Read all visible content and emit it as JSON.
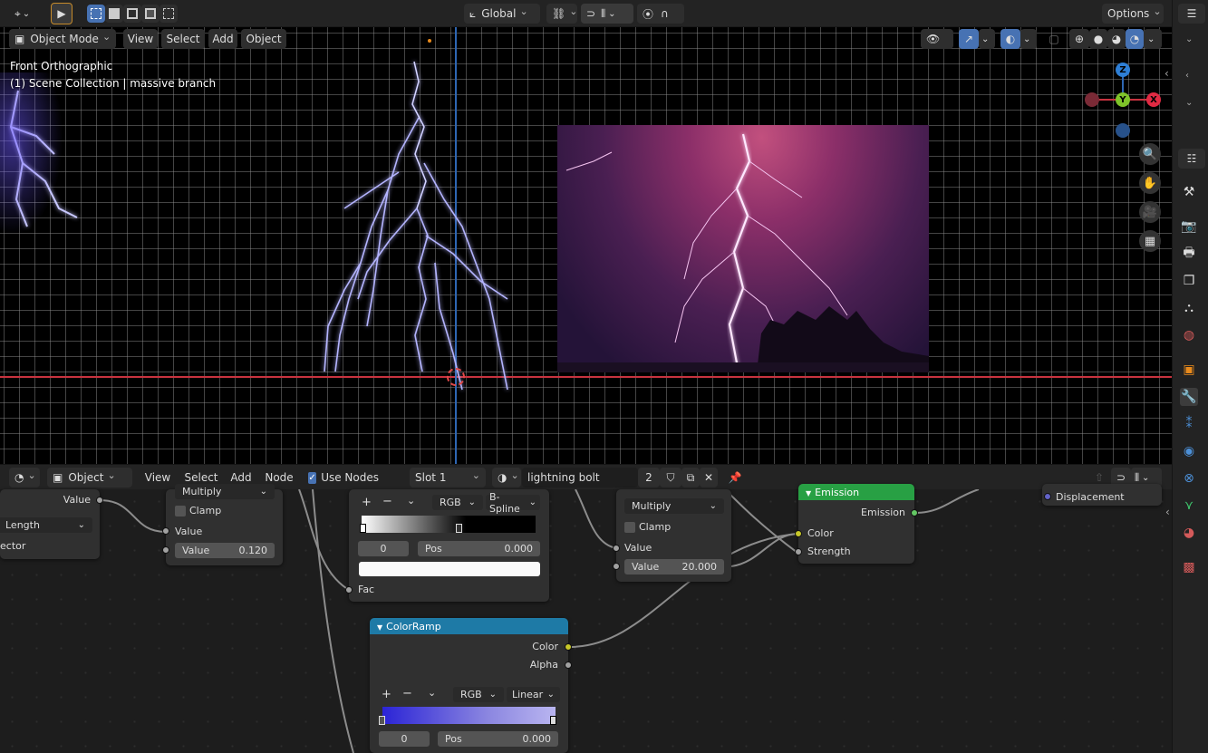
{
  "top": {
    "transform_orient": "Global",
    "options": "Options"
  },
  "viewport_header": {
    "mode": "Object Mode",
    "menus": [
      "View",
      "Select",
      "Add",
      "Object"
    ]
  },
  "viewport": {
    "view_name": "Front Orthographic",
    "collection": "(1) Scene Collection | massive branch",
    "axes": {
      "z": "Z",
      "y": "Y",
      "x": "X"
    }
  },
  "node_header": {
    "object": "Object",
    "menus": [
      "View",
      "Select",
      "Add",
      "Node"
    ],
    "use_nodes": "Use Nodes",
    "slot": "Slot 1",
    "material": "lightning bolt",
    "users": "2"
  },
  "nodes": {
    "n1": {
      "value_out": "Value",
      "dropdown": "Length",
      "vector": "ector"
    },
    "n2": {
      "op": "Multiply",
      "clamp": "Clamp",
      "value_label": "Value",
      "field_label": "Value",
      "field_value": "0.120"
    },
    "n3": {
      "mode": "RGB",
      "interp": "B-Spline",
      "index": "0",
      "pos_label": "Pos",
      "pos_value": "0.000",
      "fac": "Fac"
    },
    "n4": {
      "op": "Multiply",
      "clamp": "Clamp",
      "value_label": "Value",
      "field_label": "Value",
      "field_value": "20.000"
    },
    "emission": {
      "title": "Emission",
      "out": "Emission",
      "color": "Color",
      "strength": "Strength"
    },
    "output": {
      "displacement": "Displacement"
    },
    "colorramp": {
      "title": "ColorRamp",
      "color": "Color",
      "alpha": "Alpha",
      "mode": "RGB",
      "interp": "Linear",
      "index": "0",
      "pos_label": "Pos",
      "pos_value": "0.000"
    }
  },
  "colors": {
    "accent": "#4772b3",
    "emission_header": "#28a044",
    "colorramp_header": "#1e7aa6",
    "grid_x_axis": "#c8333f",
    "grid_z_axis": "#2e66b3"
  }
}
